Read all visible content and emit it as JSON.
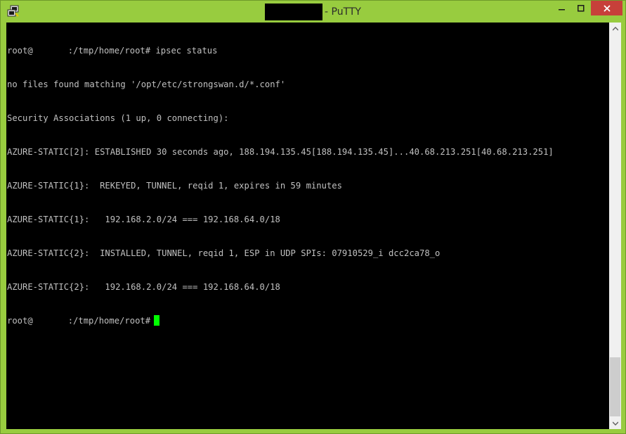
{
  "window": {
    "title_suffix": "- PuTTY",
    "icons": {
      "app": "putty-icon",
      "minimize": "minimize-icon",
      "maximize": "maximize-icon",
      "close": "close-icon",
      "scroll_up": "chevron-up-icon",
      "scroll_down": "chevron-down-icon"
    },
    "colors": {
      "frame": "#98cc3f",
      "close_button": "#c7403a",
      "terminal_bg": "#000000",
      "terminal_text": "#c0c0c0",
      "cursor": "#00ff00"
    }
  },
  "terminal": {
    "prompt_user": "root@",
    "prompt_path": ":/tmp/home/root#",
    "command": "ipsec status",
    "lines": [
      "no files found matching '/opt/etc/strongswan.d/*.conf'",
      "Security Associations (1 up, 0 connecting):",
      "AZURE-STATIC[2]: ESTABLISHED 30 seconds ago, 188.194.135.45[188.194.135.45]...40.68.213.251[40.68.213.251]",
      "AZURE-STATIC{1}:  REKEYED, TUNNEL, reqid 1, expires in 59 minutes",
      "AZURE-STATIC{1}:   192.168.2.0/24 === 192.168.64.0/18",
      "AZURE-STATIC{2}:  INSTALLED, TUNNEL, reqid 1, ESP in UDP SPIs: 07910529_i dcc2ca78_o",
      "AZURE-STATIC{2}:   192.168.2.0/24 === 192.168.64.0/18"
    ]
  }
}
